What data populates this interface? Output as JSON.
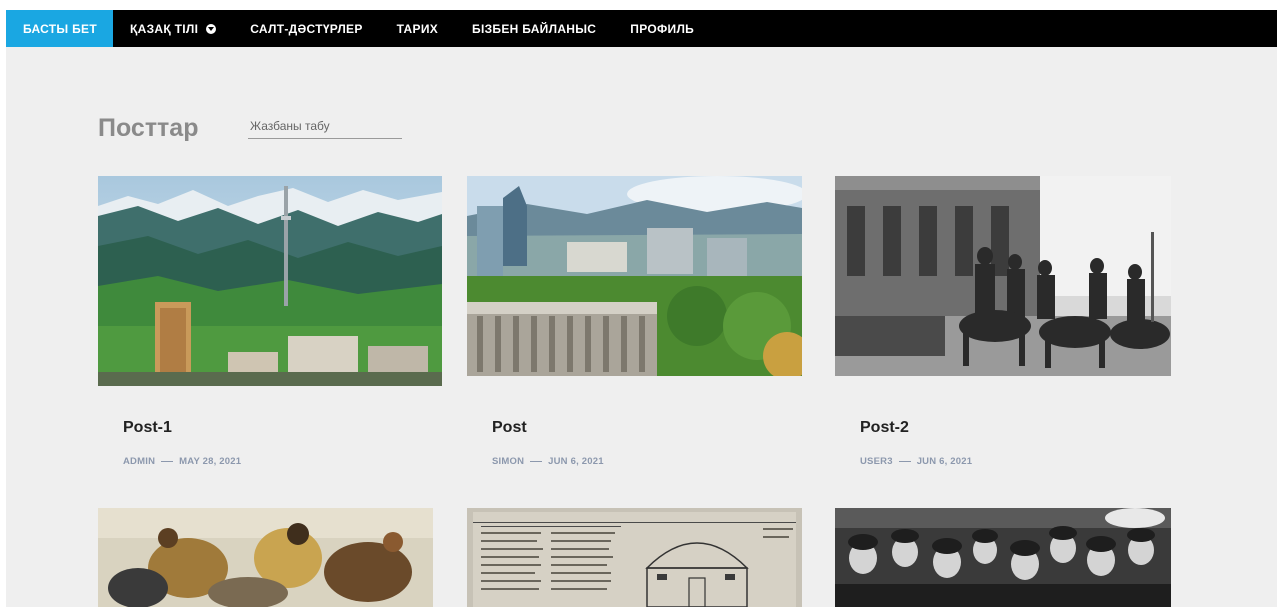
{
  "nav": {
    "items": [
      {
        "label": "БАСТЫ БЕТ",
        "active": true
      },
      {
        "label": "ҚАЗАҚ ТІЛІ",
        "has_dropdown": true
      },
      {
        "label": "САЛТ-ДӘСТҮРЛЕР"
      },
      {
        "label": "ТАРИХ"
      },
      {
        "label": "БІЗБЕН БАЙЛАНЫС"
      },
      {
        "label": "ПРОФИЛЬ"
      }
    ],
    "active_color": "#1aa7e2",
    "background": "#000000"
  },
  "page": {
    "title": "Посттар",
    "search_placeholder": "Жазбаны табу"
  },
  "posts": [
    {
      "title": "Post-1",
      "author": "ADMIN",
      "date": "MAY 28, 2021",
      "image": "almaty-mountains-tower"
    },
    {
      "title": "Post",
      "author": "SIMON",
      "date": "JUN 6, 2021",
      "image": "almaty-city-view"
    },
    {
      "title": "Post-2",
      "author": "USER3",
      "date": "JUN 6, 2021",
      "image": "historic-cavalry-photo"
    },
    {
      "image": "battle-painting"
    },
    {
      "image": "old-newspaper-yurt"
    },
    {
      "image": "crowd-photo"
    }
  ]
}
